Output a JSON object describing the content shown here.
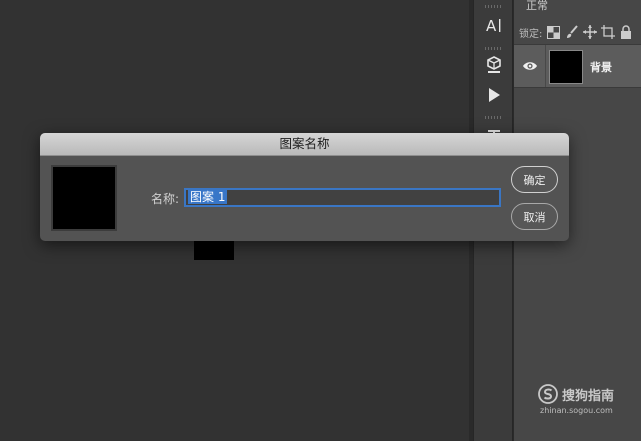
{
  "panel": {
    "blend_mode": "正常",
    "lock_label": "锁定:",
    "layer": {
      "name": "背景"
    }
  },
  "dialog": {
    "title": "图案名称",
    "name_label": "名称:",
    "name_value": "图案 1",
    "ok_label": "确定",
    "cancel_label": "取消"
  },
  "tools": [
    "character-panel-icon",
    "3d-object-icon",
    "play-action-icon",
    "paragraph-icon"
  ],
  "watermark": {
    "text": "搜狗指南",
    "url": "zhinan.sogou.com"
  },
  "colors": {
    "background": "#323232",
    "panel": "#474747",
    "dialog": "#535353",
    "selection": "#3876c8"
  }
}
